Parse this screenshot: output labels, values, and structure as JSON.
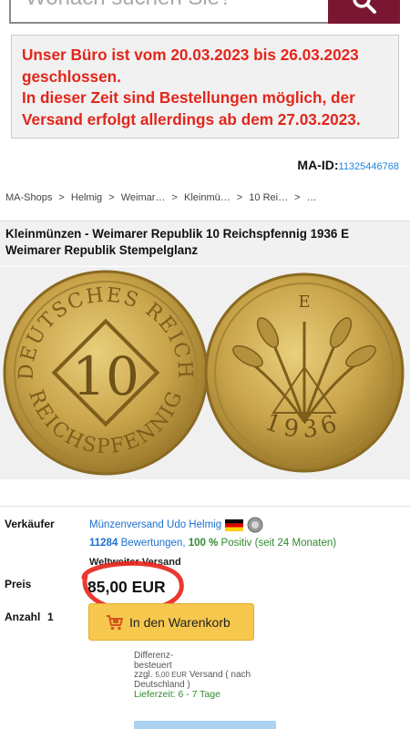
{
  "search": {
    "placeholder": "Wonach suchen Sie?",
    "button_icon": "search-icon"
  },
  "notice": {
    "lines": [
      "Unser Büro ist vom 20.03.2023 bis 26.03.2023",
      "geschlossen.",
      "In dieser Zeit sind Bestellungen möglich, der",
      "Versand erfolgt allerdings ab dem 27.03.2023."
    ]
  },
  "maid": {
    "label": "MA-ID:",
    "value": "11325446768"
  },
  "breadcrumb": [
    "MA-Shops",
    ">",
    "Helmig",
    ">",
    "Weimar…",
    ">",
    "Kleinmü…",
    ">",
    "10 Rei…",
    ">",
    "…"
  ],
  "product": {
    "title_line1": "Kleinmünzen - Weimarer Republik 10 Reichspfennig 1936 E",
    "title_line2": "Weimarer Republik Stempelglanz"
  },
  "coin": {
    "obverse_top": "DEUTSCHES REICH",
    "obverse_value": "10",
    "obverse_bottom": "REICHSPFENNIG",
    "reverse_mint": "E",
    "reverse_year": "1936"
  },
  "seller": {
    "label": "Verkäufer",
    "name": "Münzenversand Udo Helmig",
    "ratings_count": "11284",
    "ratings_text": "Bewertungen,",
    "positive_pct": "100 %",
    "positive_text": "Positiv (seit 24 Monaten)",
    "shipping": "Weltweiter Versand"
  },
  "price": {
    "label": "Preis",
    "value": "85,00 EUR"
  },
  "quantity": {
    "label": "Anzahl",
    "value": "1"
  },
  "cart": {
    "label": "In den Warenkorb"
  },
  "tax_note": {
    "line1": "Differenz-",
    "line2": "besteuert",
    "line3_pre": "zzgl.",
    "line3_amount": "5,00 EUR",
    "line3_post": "Versand ( nach",
    "line4": "Deutschland )",
    "delivery": "Lieferzeit: 6 - 7 Tage"
  },
  "colors": {
    "brand": "#7b1632",
    "notice_red": "#e3261b",
    "link_blue": "#1e6fd0",
    "cart_yellow": "#f6c84e",
    "annotation_red": "#e8231a"
  }
}
